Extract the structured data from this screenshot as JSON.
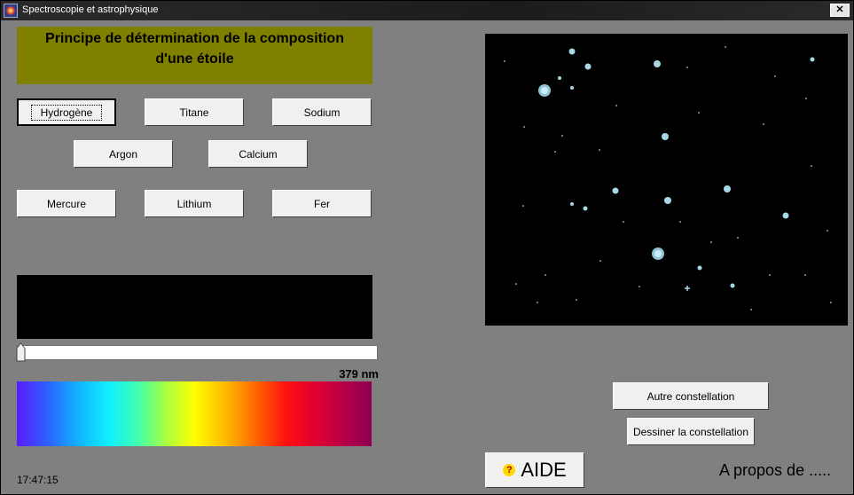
{
  "window": {
    "title": "Spectroscopie et astrophysique",
    "close_glyph": "✕"
  },
  "headline": {
    "line1": "Principe de détermination de la composition",
    "line2": "d'une étoile"
  },
  "elements": {
    "hydrogene": "Hydrogène",
    "titane": "Titane",
    "sodium": "Sodium",
    "argon": "Argon",
    "calcium": "Calcium",
    "mercure": "Mercure",
    "lithium": "Lithium",
    "fer": "Fer"
  },
  "wavelength": {
    "readout": "379 nm"
  },
  "clock": "17:47:15",
  "actions": {
    "other_constellation": "Autre constellation",
    "draw_constellation": "Dessiner la constellation",
    "help": "AIDE",
    "help_icon_glyph": "?",
    "about": "A propos de ....."
  },
  "colors": {
    "background": "#808080",
    "headline_bg": "#808000",
    "sky": "#000000",
    "star": "#a8d8e8"
  }
}
